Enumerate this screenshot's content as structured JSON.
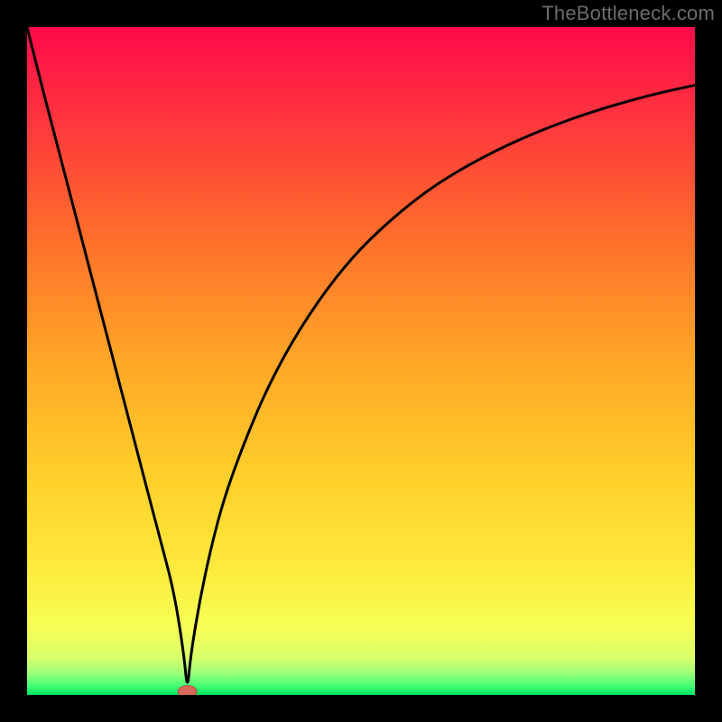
{
  "watermark": "TheBottleneck.com",
  "colors": {
    "frame": "#000000",
    "curve": "#000000",
    "marker_fill": "#d86a5c",
    "marker_stroke": "#b24b3f",
    "gradient_stops": [
      {
        "offset": 0.0,
        "color": "#ff0a4a"
      },
      {
        "offset": 0.12,
        "color": "#ff2f3f"
      },
      {
        "offset": 0.3,
        "color": "#ff6a2c"
      },
      {
        "offset": 0.5,
        "color": "#ffa726"
      },
      {
        "offset": 0.68,
        "color": "#ffd12a"
      },
      {
        "offset": 0.8,
        "color": "#ffe83a"
      },
      {
        "offset": 0.9,
        "color": "#f6ff55"
      },
      {
        "offset": 0.945,
        "color": "#d8ff6a"
      },
      {
        "offset": 0.965,
        "color": "#a6ff7a"
      },
      {
        "offset": 0.985,
        "color": "#4bff74"
      },
      {
        "offset": 1.0,
        "color": "#00e565"
      }
    ]
  },
  "chart_data": {
    "type": "line",
    "title": "",
    "xlabel": "",
    "ylabel": "",
    "xlim": [
      0,
      100
    ],
    "ylim": [
      0,
      100
    ],
    "grid": false,
    "legend": false,
    "series": [
      {
        "name": "bottleneck-curve",
        "x": [
          0,
          2,
          5,
          8,
          11,
          14,
          17,
          20,
          22,
          23.5,
          24,
          24.5,
          26,
          28,
          30,
          33,
          36,
          40,
          45,
          50,
          56,
          62,
          70,
          78,
          86,
          94,
          100
        ],
        "y": [
          100,
          92,
          80.5,
          69,
          57.5,
          46,
          34.5,
          23,
          15.5,
          6,
          0.5,
          6,
          15,
          24,
          31,
          39,
          46,
          53.5,
          61,
          67,
          72.5,
          77,
          81.5,
          85,
          87.8,
          90,
          91.3
        ]
      }
    ],
    "marker": {
      "x": 24,
      "y": 0.5,
      "rx": 1.4,
      "ry": 0.9
    },
    "notes": "x is normalized horizontal position (0=left edge of plot, 100=right). y is normalized vertical value (0=bottom green, 100=top red). Curve is a V whose minimum (optimum) sits near x≈24."
  }
}
